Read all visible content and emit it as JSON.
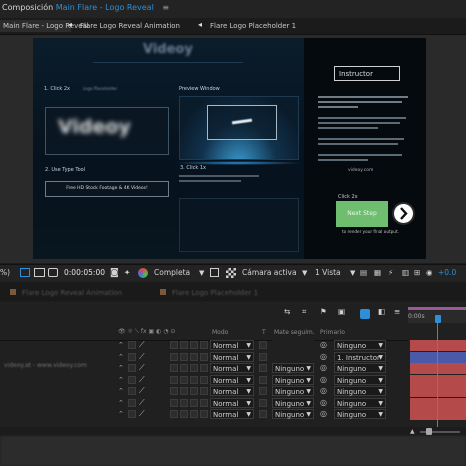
{
  "header": {
    "comp_prefix": "Composición",
    "comp_name": "Main Flare - Logo Reveal",
    "close_glyph": "≡"
  },
  "comp_tabs": [
    {
      "label": "Main Flare - Logo Reveal"
    },
    {
      "label": "Flare Logo Reveal Animation"
    },
    {
      "label": "Flare Logo Placeholder 1"
    }
  ],
  "canvas": {
    "logo_text": "Videoy",
    "step1_title": "1. Click 2x",
    "step1_sub": "Logo Placeholder",
    "preview_title": "Preview Window",
    "step2_title": "2. Use Type Tool",
    "step2_button": "Free HD Stock Footage & 4K Videos!",
    "step3_title": "3. Click 1x",
    "instructor_label": "Instructor",
    "welcome_text": "Welcome to our walkthrough and thank you for purchasing Flare Logo Reveal",
    "site": "videoy.com",
    "click_hint": "Click 2x",
    "next_button": "Next Step",
    "render_hint": "to render your final output."
  },
  "viewer_toolbar": {
    "zoom": "%)",
    "timecode": "0:00:05:00",
    "resolution": "Completa",
    "camera": "Cámara activa",
    "views": "1 Vista",
    "exposure": "+0.0"
  },
  "timeline_tabs": [
    {
      "label": "Flare Logo Reveal Animation"
    },
    {
      "label": "Flare Logo Placeholder 1"
    }
  ],
  "timeline": {
    "ruler_label": "0:00s",
    "col_mode": "Modo",
    "col_t": "T",
    "col_track": "Mate seguim.",
    "col_parent": "Primario",
    "layer_text": "videoy.at - www.videoy.com",
    "rows": [
      {
        "mode": "Normal",
        "track": "",
        "parent": "Ninguno"
      },
      {
        "mode": "Normal",
        "track": "",
        "parent": "1. Instructor"
      },
      {
        "mode": "Normal",
        "track": "Ninguno",
        "parent": "Ninguno"
      },
      {
        "mode": "Normal",
        "track": "Ninguno",
        "parent": "Ninguno"
      },
      {
        "mode": "Normal",
        "track": "Ninguno",
        "parent": "Ninguno"
      },
      {
        "mode": "Normal",
        "track": "Ninguno",
        "parent": "Ninguno"
      },
      {
        "mode": "Normal",
        "track": "Ninguno",
        "parent": "Ninguno"
      }
    ]
  },
  "colors": {
    "accent_blue": "#2e8fd6",
    "next_step_green": "#6fbe6f",
    "track_red": "#b44a4a",
    "track_blue": "#4b5aa8"
  }
}
